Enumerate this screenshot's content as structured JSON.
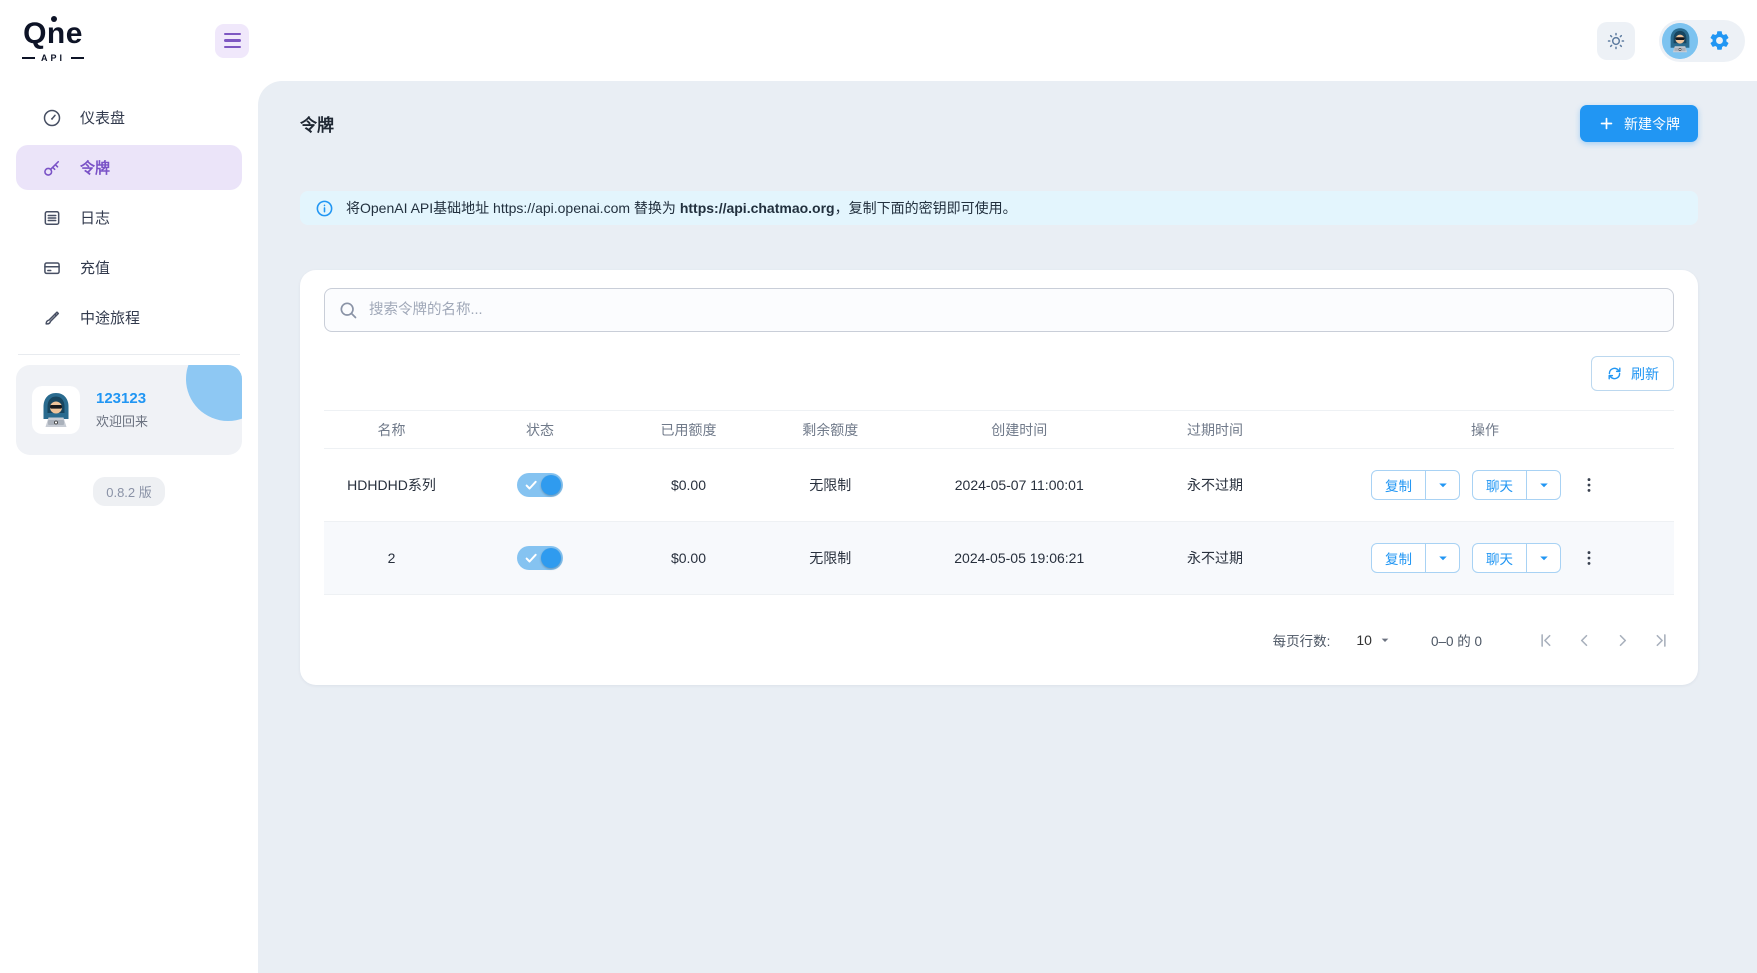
{
  "brand": {
    "name": "Qne",
    "sub": "API"
  },
  "colors": {
    "accent": "#2196f3",
    "purple": "#7e57c2",
    "main_bg": "#e9eef4",
    "banner_bg": "#e3f5fd",
    "toggle_track": "#85c3f1"
  },
  "sidebar": {
    "items": [
      {
        "label": "仪表盘",
        "icon": "dashboard-icon",
        "active": false
      },
      {
        "label": "令牌",
        "icon": "key-icon",
        "active": true
      },
      {
        "label": "日志",
        "icon": "logs-icon",
        "active": false
      },
      {
        "label": "充值",
        "icon": "recharge-icon",
        "active": false
      },
      {
        "label": "中途旅程",
        "icon": "brush-icon",
        "active": false
      }
    ],
    "user": {
      "name": "123123",
      "greeting": "欢迎回来"
    },
    "version": "0.8.2 版"
  },
  "page": {
    "title": "令牌",
    "new_token_button": "新建令牌",
    "banner": {
      "prefix": "将OpenAI API基础地址 https://api.openai.com 替换为 ",
      "bold": "https://api.chatmao.org",
      "suffix": "，复制下面的密钥即可使用。"
    },
    "search": {
      "placeholder": "搜索令牌的名称..."
    },
    "refresh_button": "刷新",
    "table": {
      "columns": [
        "名称",
        "状态",
        "已用额度",
        "剩余额度",
        "创建时间",
        "过期时间",
        "操作"
      ],
      "actions": {
        "copy": "复制",
        "chat": "聊天"
      },
      "rows": [
        {
          "name": "HDHDHD系列",
          "status_on": true,
          "used": "$0.00",
          "remaining": "无限制",
          "created": "2024-05-07 11:00:01",
          "expires": "永不过期"
        },
        {
          "name": "2",
          "status_on": true,
          "used": "$0.00",
          "remaining": "无限制",
          "created": "2024-05-05 19:06:21",
          "expires": "永不过期"
        }
      ]
    },
    "pagination": {
      "rows_per_page_label": "每页行数:",
      "rows_per_page": "10",
      "range": "0–0 的 0"
    }
  }
}
